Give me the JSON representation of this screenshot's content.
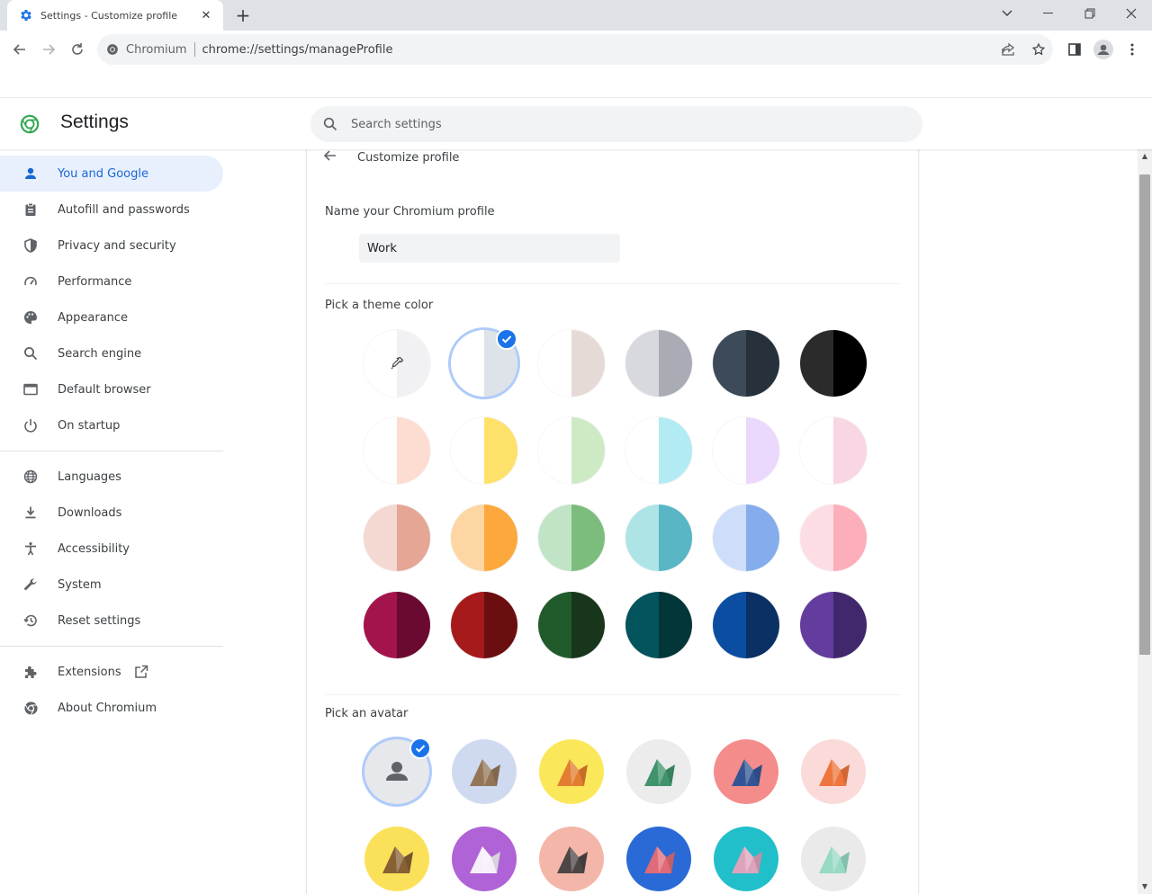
{
  "browser": {
    "tab_title": "Settings - Customize profile",
    "site_chip": "Chromium",
    "url": "chrome://settings/manageProfile"
  },
  "header": {
    "title": "Settings",
    "search_placeholder": "Search settings"
  },
  "sidebar": {
    "items": [
      {
        "label": "You and Google",
        "icon": "person-icon"
      },
      {
        "label": "Autofill and passwords",
        "icon": "clipboard-icon"
      },
      {
        "label": "Privacy and security",
        "icon": "shield-icon"
      },
      {
        "label": "Performance",
        "icon": "speedometer-icon"
      },
      {
        "label": "Appearance",
        "icon": "palette-icon"
      },
      {
        "label": "Search engine",
        "icon": "search-icon"
      },
      {
        "label": "Default browser",
        "icon": "browser-window-icon"
      },
      {
        "label": "On startup",
        "icon": "power-icon"
      },
      {
        "label": "Languages",
        "icon": "globe-icon"
      },
      {
        "label": "Downloads",
        "icon": "download-icon"
      },
      {
        "label": "Accessibility",
        "icon": "accessibility-icon"
      },
      {
        "label": "System",
        "icon": "wrench-icon"
      },
      {
        "label": "Reset settings",
        "icon": "history-icon"
      },
      {
        "label": "Extensions",
        "icon": "puzzle-icon"
      },
      {
        "label": "About Chromium",
        "icon": "chromium-icon"
      }
    ]
  },
  "page": {
    "subpage_title": "Customize profile",
    "name_label": "Name your Chromium profile",
    "name_value": "Work",
    "theme_label": "Pick a theme color",
    "avatar_label": "Pick an avatar"
  },
  "theme_colors": [
    {
      "name": "custom-color",
      "left": "#ffffff",
      "right": "#f1f1f4"
    },
    {
      "name": "default-blue-grey",
      "left": "#ffffff",
      "right": "#dee3e9",
      "selected": true
    },
    {
      "name": "warm-grey",
      "left": "#ffffff",
      "right": "#e6dad7"
    },
    {
      "name": "cool-grey",
      "left": "#d8d9de",
      "right": "#a9abb5"
    },
    {
      "name": "slate",
      "left": "#3c4a59",
      "right": "#26313b"
    },
    {
      "name": "black",
      "left": "#2b2b2b",
      "right": "#000000"
    },
    {
      "name": "peach",
      "left": "#ffffff",
      "right": "#fddcd1"
    },
    {
      "name": "yellow",
      "left": "#ffffff",
      "right": "#fee16a"
    },
    {
      "name": "light-green",
      "left": "#ffffff",
      "right": "#cdeac5"
    },
    {
      "name": "light-cyan",
      "left": "#ffffff",
      "right": "#b2ebf3"
    },
    {
      "name": "lavender",
      "left": "#ffffff",
      "right": "#ead9fc"
    },
    {
      "name": "light-pink",
      "left": "#ffffff",
      "right": "#f8d6e3"
    },
    {
      "name": "salmon",
      "left": "#f4d9d3",
      "right": "#e5a696"
    },
    {
      "name": "orange",
      "left": "#fdd6a3",
      "right": "#fda83d"
    },
    {
      "name": "green",
      "left": "#c2e4c6",
      "right": "#7cbd7e"
    },
    {
      "name": "teal",
      "left": "#aee4e6",
      "right": "#58b6c5"
    },
    {
      "name": "blue",
      "left": "#cdddfa",
      "right": "#85adec"
    },
    {
      "name": "pink",
      "left": "#fddde4",
      "right": "#fdaebb"
    },
    {
      "name": "crimson",
      "left": "#a3144c",
      "right": "#6a0a31"
    },
    {
      "name": "red",
      "left": "#a71a1c",
      "right": "#6b0e10"
    },
    {
      "name": "dark-green",
      "left": "#225b2b",
      "right": "#18361c"
    },
    {
      "name": "dark-teal",
      "left": "#03545c",
      "right": "#033638"
    },
    {
      "name": "navy",
      "left": "#0b4da0",
      "right": "#0a3064"
    },
    {
      "name": "purple",
      "left": "#643c9e",
      "right": "#41286c"
    }
  ],
  "avatars": [
    {
      "name": "generic-person-avatar",
      "bg": "#e6e8ec",
      "fg": "#5f6368",
      "selected": true
    },
    {
      "name": "cat-avatar",
      "bg": "#cfdaf0",
      "fg": "#8c6a46"
    },
    {
      "name": "corgi-avatar",
      "bg": "#fbe85a",
      "fg": "#e0712a"
    },
    {
      "name": "dragon-avatar",
      "bg": "#ececec",
      "fg": "#2e8a5d"
    },
    {
      "name": "elephant-avatar",
      "bg": "#f58c8c",
      "fg": "#1f4f96"
    },
    {
      "name": "fox-avatar",
      "bg": "#fbdada",
      "fg": "#ec6a2a"
    },
    {
      "name": "monkey-avatar",
      "bg": "#fbe05a",
      "fg": "#7a5230"
    },
    {
      "name": "panda-avatar",
      "bg": "#b063d6",
      "fg": "#ffffff"
    },
    {
      "name": "penguin-avatar",
      "bg": "#f3b6a8",
      "fg": "#3a3a3a"
    },
    {
      "name": "butterfly-avatar",
      "bg": "#2a6ad6",
      "fg": "#f46b6b"
    },
    {
      "name": "rabbit-avatar",
      "bg": "#21bfc9",
      "fg": "#f3a0ba"
    },
    {
      "name": "unicorn-avatar",
      "bg": "#eaeaea",
      "fg": "#8fd7c0"
    }
  ]
}
